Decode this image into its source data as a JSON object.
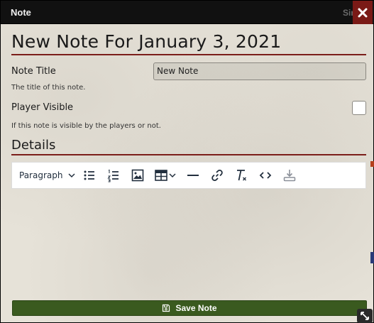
{
  "window": {
    "title": "Note",
    "behind_text": "Simple",
    "close_icon": "close-icon"
  },
  "heading": "New Note For January 3, 2021",
  "fields": {
    "note_title": {
      "label": "Note Title",
      "value": "New Note",
      "hint": "The title of this note."
    },
    "player_visible": {
      "label": "Player Visible",
      "checked": false,
      "hint": "If this note is visible by the players or not."
    }
  },
  "details": {
    "heading": "Details",
    "toolbar": {
      "block_format": "Paragraph",
      "buttons": [
        "bullet-list-icon",
        "numbered-list-icon",
        "image-icon",
        "table-icon",
        "horizontal-rule-icon",
        "link-icon",
        "clear-formatting-icon",
        "code-icon",
        "download-icon"
      ]
    }
  },
  "save_button": {
    "label": "Save Note",
    "icon": "save-icon"
  },
  "colors": {
    "titlebar": "#111111",
    "close_button": "#7a1a16",
    "heading_rule": "#7b1e1a",
    "save_button": "#3a5a1f",
    "background": "#e6e2d8"
  }
}
